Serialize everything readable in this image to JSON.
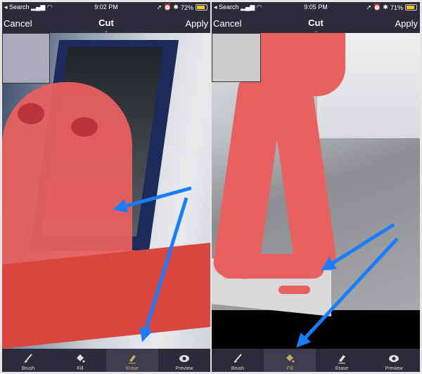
{
  "screens": [
    {
      "status": {
        "back": "Search",
        "time": "9:02 PM",
        "battery": "72%",
        "battery_level": 0.72
      },
      "nav": {
        "cancel": "Cancel",
        "title": "Cut",
        "apply": "Apply"
      },
      "tools": [
        {
          "label": "Brush",
          "icon": "brush-icon"
        },
        {
          "label": "Fill",
          "icon": "fill-bucket-icon"
        },
        {
          "label": "Erase",
          "icon": "eraser-icon"
        },
        {
          "label": "Preview",
          "icon": "eye-icon"
        }
      ],
      "selected_tool": "Erase"
    },
    {
      "status": {
        "back": "Search",
        "time": "9:05 PM",
        "battery": "71%",
        "battery_level": 0.71
      },
      "nav": {
        "cancel": "Cancel",
        "title": "Cut",
        "apply": "Apply"
      },
      "tools": [
        {
          "label": "Brush",
          "icon": "brush-icon"
        },
        {
          "label": "Fill",
          "icon": "fill-bucket-icon"
        },
        {
          "label": "Erase",
          "icon": "eraser-icon"
        },
        {
          "label": "Preview",
          "icon": "eye-icon"
        }
      ],
      "selected_tool": "Fill"
    }
  ],
  "colors": {
    "accent": "#c9a95f",
    "mask": "#e8605f",
    "arrow": "#1a7cff"
  }
}
